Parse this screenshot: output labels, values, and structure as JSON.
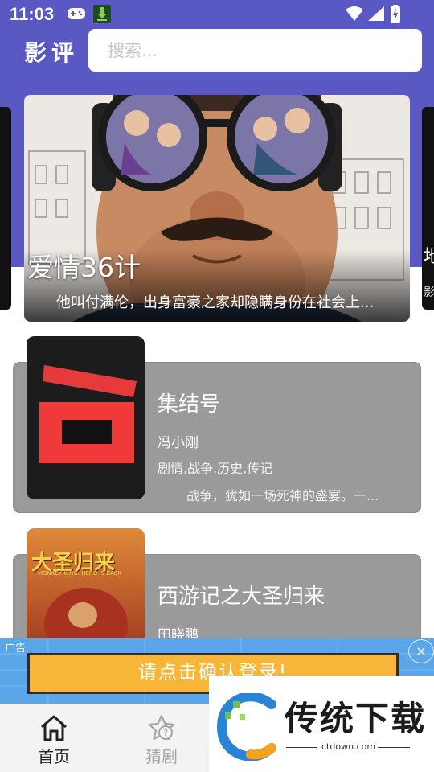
{
  "status_bar": {
    "time": "11:03"
  },
  "header": {
    "title": "影评",
    "search_placeholder": "搜索..."
  },
  "carousel": {
    "current": {
      "title": "爱情36计",
      "description": "他叫付满伦，出身富豪之家却隐瞒身份在社会上..."
    },
    "right_peek": {
      "title": "地",
      "subtitle": "影"
    }
  },
  "movies": [
    {
      "title": "集结号",
      "director": "冯小刚",
      "genres": "剧情,战争,历史,传记",
      "summary": "战争，犹如一场死神的盛宴。一..."
    },
    {
      "title": "西游记之大圣归来",
      "director": "田晓鹏",
      "poster_text": "大圣归来",
      "poster_subtext": "MONKEY KING: HERO IS BACK"
    }
  ],
  "ad": {
    "label": "广告",
    "button": "请点击确认登录!",
    "close": "×"
  },
  "bottom_nav": [
    {
      "label": "首页",
      "active": true
    },
    {
      "label": "猜剧",
      "active": false
    }
  ],
  "watermark": {
    "brand": "传统下载",
    "site": "ctdown.com"
  },
  "colors": {
    "header": "#5a58c3",
    "card": "#9a9a9a",
    "ad": "#5aa6e8",
    "ad_button": "#f7b637",
    "nav_active": "#222222",
    "nav_inactive": "#a5a5a5"
  }
}
